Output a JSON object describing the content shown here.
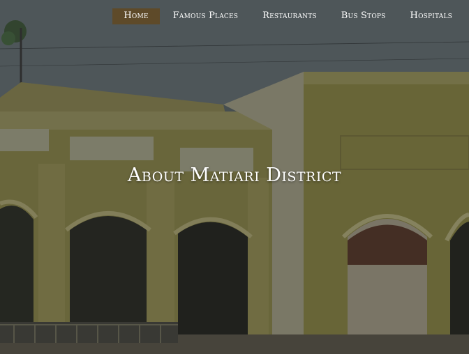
{
  "nav": {
    "items": [
      {
        "label": "Home",
        "active": true
      },
      {
        "label": "Famous Places",
        "active": false
      },
      {
        "label": "Restaurants",
        "active": false
      },
      {
        "label": "Bus Stops",
        "active": false
      },
      {
        "label": "Hospitals",
        "active": false
      }
    ]
  },
  "hero": {
    "title": "About Matiari District"
  },
  "colors": {
    "active_nav_bg": "#5e4a29",
    "text": "#ffffff"
  }
}
